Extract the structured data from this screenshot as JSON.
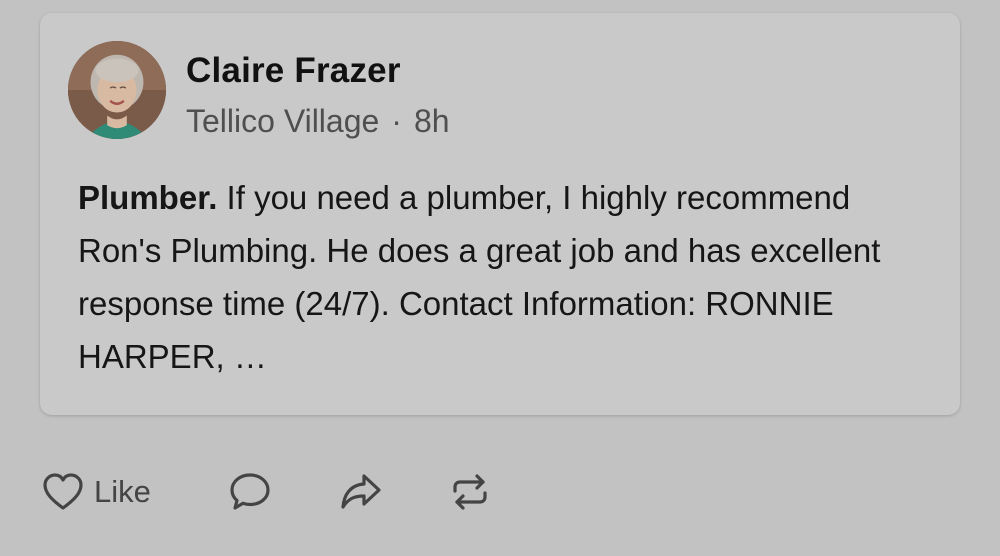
{
  "post": {
    "author": "Claire Frazer",
    "location": "Tellico Village",
    "separator": "·",
    "time": "8h",
    "lead": "Plumber.",
    "body": " If you need a plumber, I highly recommend Ron's Plumbing. He does a great job and has excellent response time (24/7). Contact Information: RONNIE HARPER, …"
  },
  "actions": {
    "like_label": "Like",
    "like_icon": "heart-icon",
    "comment_icon": "comment-icon",
    "share_icon": "share-icon",
    "repost_icon": "repost-icon"
  },
  "colors": {
    "background": "#c2c2c2",
    "card": "#c9c9c9",
    "text": "#111111",
    "muted": "#4f4f4f"
  }
}
